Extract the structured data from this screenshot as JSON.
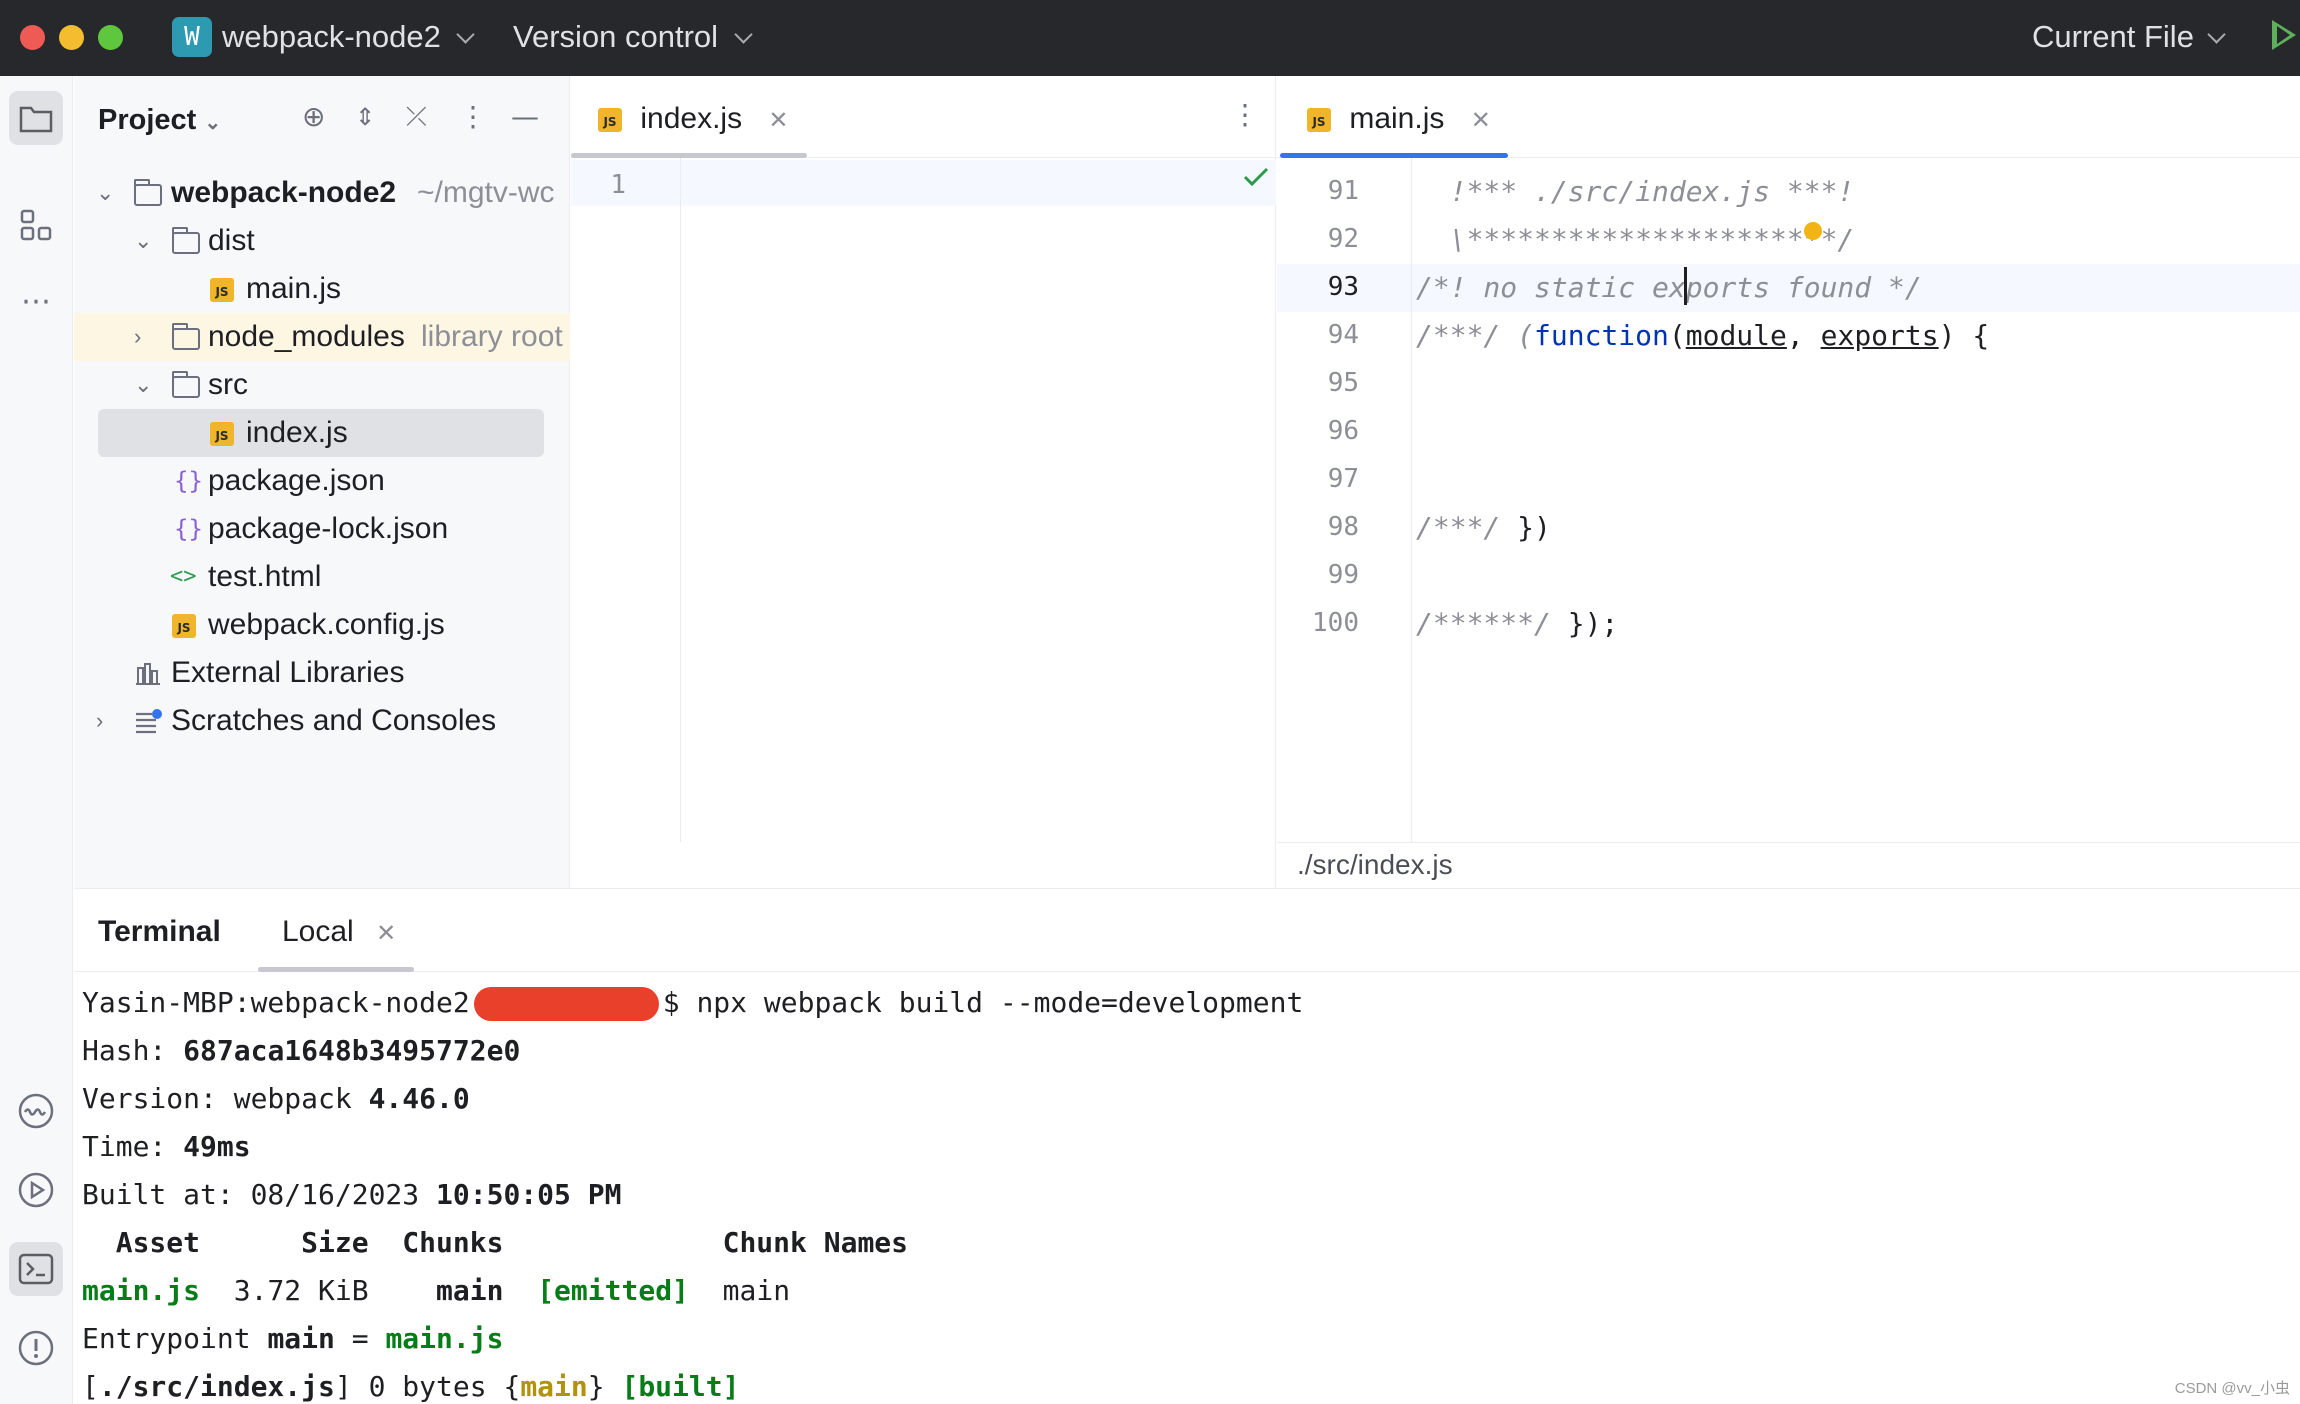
{
  "titlebar": {
    "project_badge": "W",
    "project_name": "webpack-node2",
    "vcs": "Version control",
    "run_config": "Current File",
    "traffic_colors": [
      "#ee5b55",
      "#f4bd2f",
      "#5fc73d"
    ]
  },
  "project_panel": {
    "title": "Project",
    "tree": [
      {
        "label": "webpack-node2",
        "hint": "~/mgtv-wc",
        "icon": "folder-icon",
        "expanded": true
      },
      {
        "label": "dist",
        "icon": "folder-icon",
        "expanded": true
      },
      {
        "label": "main.js",
        "icon": "js-file-icon"
      },
      {
        "label": "node_modules",
        "hint": "library root",
        "icon": "folder-icon",
        "expanded": false
      },
      {
        "label": "src",
        "icon": "folder-icon",
        "expanded": true
      },
      {
        "label": "index.js",
        "icon": "js-file-icon",
        "selected": true
      },
      {
        "label": "package.json",
        "icon": "json-file-icon"
      },
      {
        "label": "package-lock.json",
        "icon": "json-file-icon"
      },
      {
        "label": "test.html",
        "icon": "html-file-icon"
      },
      {
        "label": "webpack.config.js",
        "icon": "js-file-icon"
      },
      {
        "label": "External Libraries",
        "icon": "library-icon"
      },
      {
        "label": "Scratches and Consoles",
        "icon": "scratches-icon"
      }
    ]
  },
  "editor_left": {
    "tab": "index.js",
    "js_badge": "JS",
    "line_numbers": [
      "1"
    ],
    "status": "ok"
  },
  "editor_right": {
    "tab": "main.js",
    "js_badge": "JS",
    "line_numbers": [
      "91",
      "92",
      "93",
      "94",
      "95",
      "96",
      "97",
      "98",
      "99",
      "100"
    ],
    "lines": {
      "l91": "  !*** ./src/index.js ***!",
      "l92": "  \\**********************/",
      "l93": "/*! no static exports found */",
      "l94_a": "/***/ (",
      "l94_kw": "function",
      "l94_b": "(",
      "l94_p1": "module",
      "l94_c": ", ",
      "l94_p2": "exports",
      "l94_d": ") {",
      "l98_cm": "/***/",
      "l98_rest": " })",
      "l100_cm": "/******/",
      "l100_rest": " });"
    },
    "breadcrumb": "./src/index.js"
  },
  "terminal": {
    "title": "Terminal",
    "tab": "Local",
    "prompt": "Yasin-MBP:webpack-node2",
    "command": "$ npx webpack build --mode=development",
    "hash_label": "Hash: ",
    "hash": "687aca1648b3495772e0",
    "version_label": "Version: webpack ",
    "version": "4.46.0",
    "time_label": "Time: ",
    "time": "49ms",
    "built_label": "Built at: 08/16/2023 ",
    "built_time": "10:50:05 PM",
    "table_header": "  Asset      Size  Chunks             Chunk Names",
    "asset": "main.js",
    "size": "  3.72 KiB    ",
    "chunk": "main",
    "sp1": "  ",
    "emitted": "[emitted]",
    "chunk_name": "  main",
    "entry_label": "Entrypoint ",
    "entry_name": "main",
    "entry_eq": " = ",
    "entry_file": "main.js",
    "mod_open": "[",
    "mod_path": "./src/index.js",
    "mod_mid": "] 0 bytes {",
    "mod_chunk": "main",
    "mod_close": "} ",
    "mod_built": "[built]"
  },
  "watermark": "CSDN @vv_小虫"
}
